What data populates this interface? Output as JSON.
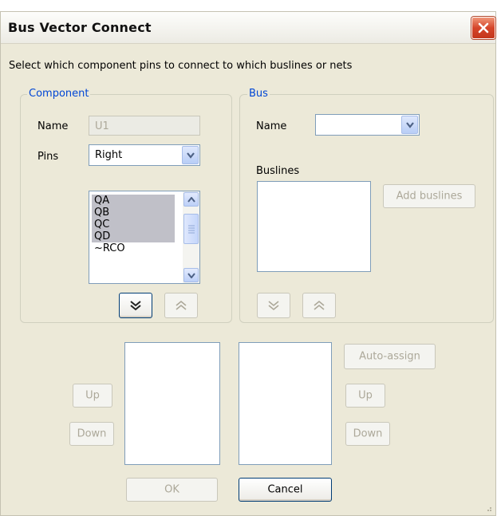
{
  "window": {
    "title": "Bus Vector Connect"
  },
  "instructions": "Select which component pins to connect to which buslines or nets",
  "component": {
    "legend": "Component",
    "name_label": "Name",
    "name_value": "U1",
    "pins_label": "Pins",
    "pins_value": "Right",
    "pins_list": [
      {
        "label": "QA",
        "selected": true
      },
      {
        "label": "QB",
        "selected": true
      },
      {
        "label": "QC",
        "selected": true
      },
      {
        "label": "QD",
        "selected": true
      },
      {
        "label": "~RCO",
        "selected": false
      }
    ]
  },
  "bus": {
    "legend": "Bus",
    "name_label": "Name",
    "name_value": "",
    "buslines_label": "Buslines",
    "add_buslines_label": "Add buslines"
  },
  "buttons": {
    "left_up": "Up",
    "left_down": "Down",
    "auto_assign": "Auto-assign",
    "right_up": "Up",
    "right_down": "Down",
    "ok": "OK",
    "cancel": "Cancel"
  },
  "icons": {
    "close": "close-icon",
    "dropdown": "chevron-down-icon",
    "scroll_up": "scroll-up-arrow-icon",
    "scroll_down": "scroll-down-arrow-icon",
    "move_down": "double-chevron-down-icon",
    "move_up": "double-chevron-up-icon",
    "resize_grip": "resize-grip-icon"
  },
  "colors": {
    "legend": "#0046d5",
    "close_button": "#d5452a",
    "dialog_bg": "#ece9d8"
  }
}
